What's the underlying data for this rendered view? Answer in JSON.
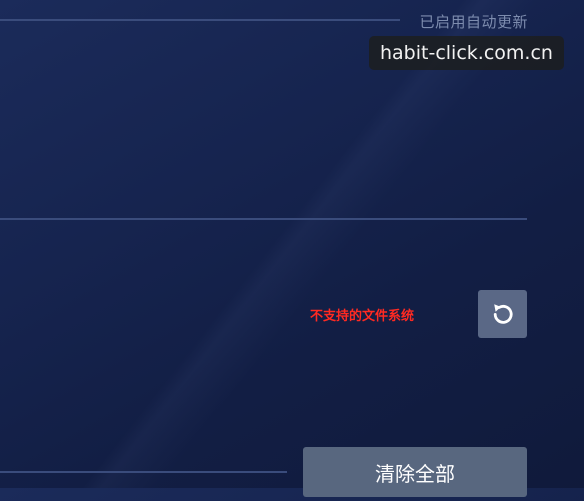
{
  "settings": {
    "auto_update_status": "已启用自动更新"
  },
  "watermark": {
    "text": "habit-click.com.cn"
  },
  "storage": {
    "error_message": "不支持的文件系统",
    "refresh_icon": "refresh-icon"
  },
  "actions": {
    "clear_all_label": "清除全部"
  },
  "colors": {
    "background": "#152350",
    "divider": "#3a4c7c",
    "error": "#ff2a22",
    "button": "#58677f"
  }
}
